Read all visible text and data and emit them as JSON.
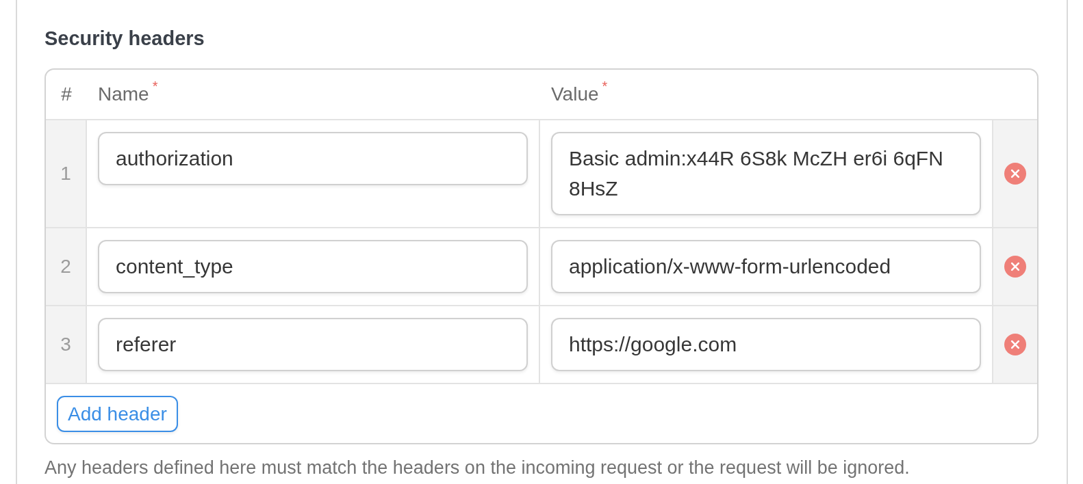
{
  "section": {
    "title": "Security headers"
  },
  "table": {
    "columns": [
      {
        "label": "#"
      },
      {
        "label": "Name",
        "required_mark": "*"
      },
      {
        "label": "Value",
        "required_mark": "*"
      }
    ],
    "rows": [
      {
        "number": "1",
        "name": "authorization",
        "value": "Basic admin:x44R 6S8k McZH er6i 6qFN 8HsZ"
      },
      {
        "number": "2",
        "name": "content_type",
        "value": "application/x-www-form-urlencoded"
      },
      {
        "number": "3",
        "name": "referer",
        "value": "https://google.com"
      }
    ],
    "add_button": "Add header"
  },
  "help_text": "Any headers defined here must match the headers on the incoming request or the request will be ignored."
}
